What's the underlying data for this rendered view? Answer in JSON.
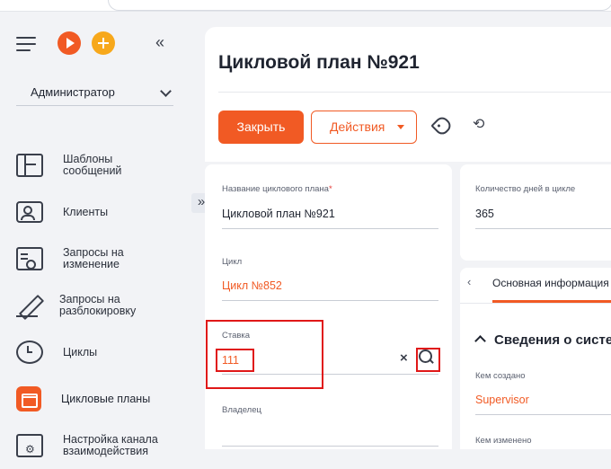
{
  "sidebar": {
    "role": "Администратор",
    "items": [
      {
        "label": "Шаблоны сообщений"
      },
      {
        "label": "Клиенты"
      },
      {
        "label": "Запросы на изменение"
      },
      {
        "label": "Запросы на разблокировку"
      },
      {
        "label": "Циклы"
      },
      {
        "label": "Цикловые планы"
      },
      {
        "label": "Настройка канала взаимодействия"
      }
    ]
  },
  "header": {
    "title": "Цикловой план №921",
    "close_label": "Закрыть",
    "actions_label": "Действия"
  },
  "form": {
    "name_label": "Название циклового плана",
    "name_required_mark": "*",
    "name_value": "Цикловой план №921",
    "cycle_label": "Цикл",
    "cycle_value": "Цикл №852",
    "rate_label": "Ставка",
    "rate_value": "111",
    "rate_clear": "×",
    "owner_label": "Владелец"
  },
  "right_panel": {
    "days_label": "Количество дней в цикле",
    "days_value": "365",
    "tab_label": "Основная информация",
    "section_title": "Сведения о системе",
    "created_by_label": "Кем создано",
    "created_by_value": "Supervisor",
    "modified_by_label": "Кем изменено"
  },
  "colors": {
    "accent": "#f15a24",
    "highlight": "#e01818",
    "background": "#f2f3f6"
  }
}
